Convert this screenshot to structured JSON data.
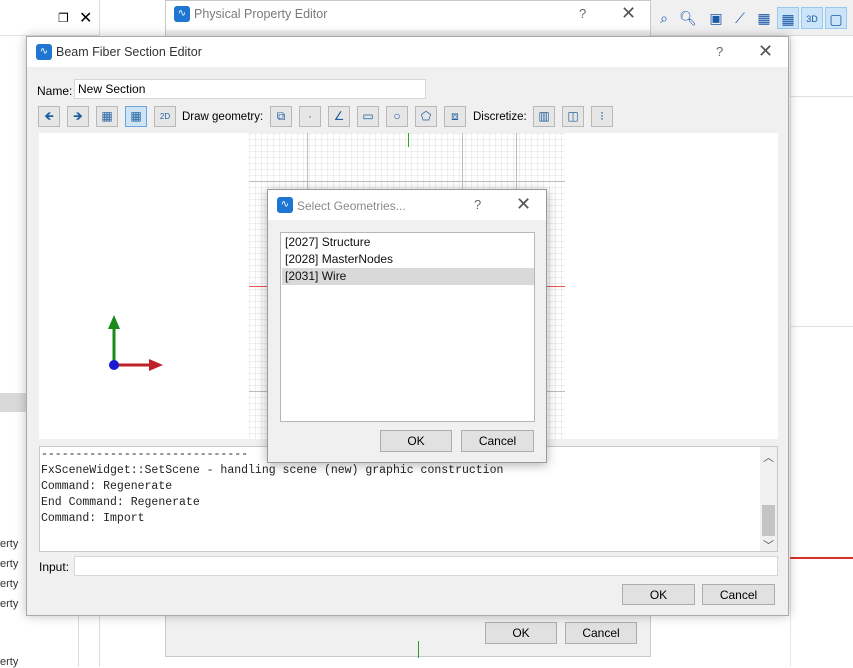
{
  "background": {
    "left_panel": {
      "property_labels": [
        "erty",
        "erty",
        "erty",
        "erty",
        "erty"
      ]
    },
    "toolbar_icons": [
      "zoom-fit-icon",
      "zoom-icon",
      "monitor-icon",
      "ruler-icon",
      "grid-icon",
      "grid-major-icon",
      "view-3d-icon",
      "section-icon"
    ]
  },
  "physical_property_editor": {
    "title": "Physical Property Editor",
    "help": "?",
    "close": "✕",
    "ok_label": "OK",
    "cancel_label": "Cancel"
  },
  "beam_fiber_section_editor": {
    "title": "Beam Fiber Section Editor",
    "help": "?",
    "close": "✕",
    "name_label": "Name:",
    "name_value": "New Section",
    "draw_geometry_label": "Draw geometry:",
    "discretize_label": "Discretize:",
    "console": {
      "lines": [
        "------------------------------",
        "FxSceneWidget::SetScene - handling scene (new) graphic construction",
        "Command: Regenerate",
        "End Command: Regenerate",
        "Command: Import"
      ]
    },
    "input_label": "Input:",
    "input_value": "",
    "ok_label": "OK",
    "cancel_label": "Cancel"
  },
  "select_geometries": {
    "title": "Select Geometries...",
    "help": "?",
    "close": "✕",
    "items": [
      {
        "label": "[2027] Structure",
        "selected": false
      },
      {
        "label": "[2028] MasterNodes",
        "selected": false
      },
      {
        "label": "[2031] Wire",
        "selected": true
      }
    ],
    "ok_label": "OK",
    "cancel_label": "Cancel"
  },
  "colors": {
    "accent": "#1f76d2",
    "axis_x": "#d9302b",
    "axis_y": "#1a8a1a",
    "origin": "#1a1ad0",
    "selection": "#d9d9d9"
  }
}
